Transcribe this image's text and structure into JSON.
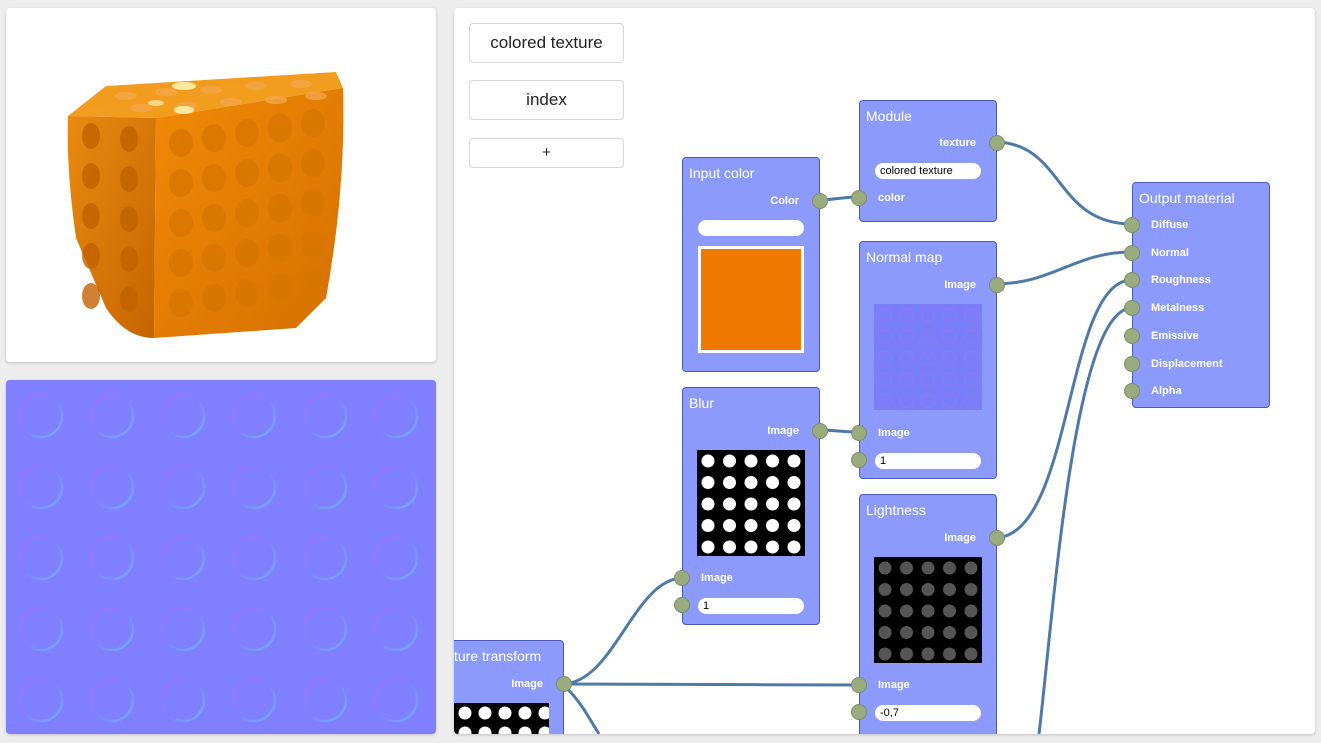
{
  "colors": {
    "node_fill": "#8c9afc",
    "node_border": "#4a58b8",
    "port": "#9aab80",
    "wire": "#4f7aa8",
    "input_color_value": "#ee7800",
    "normal_map_bg": "#8080ff"
  },
  "previews": {
    "render_label": "3d-render-preview",
    "normal_label": "normal-map-preview"
  },
  "sidebar": {
    "items": [
      {
        "label": "colored texture"
      },
      {
        "label": "index"
      },
      {
        "label": "+"
      }
    ]
  },
  "nodes": {
    "input_color": {
      "title": "Input color",
      "out": "Color",
      "value": ""
    },
    "module": {
      "title": "Module",
      "out": "texture",
      "field": "colored texture",
      "in": "color"
    },
    "normal_map": {
      "title": "Normal map",
      "out": "Image",
      "in": "Image",
      "strength": "1"
    },
    "blur": {
      "title": "Blur",
      "out": "Image",
      "in": "Image",
      "amount": "1"
    },
    "lightness": {
      "title": "Lightness",
      "out": "Image",
      "in": "Image",
      "amount": "-0,7"
    },
    "texture_transform": {
      "title": "ture transform",
      "out": "Image"
    },
    "output_material": {
      "title": "Output material",
      "inputs": [
        "Diffuse",
        "Normal",
        "Roughness",
        "Metalness",
        "Emissive",
        "Displacement",
        "Alpha"
      ]
    }
  }
}
